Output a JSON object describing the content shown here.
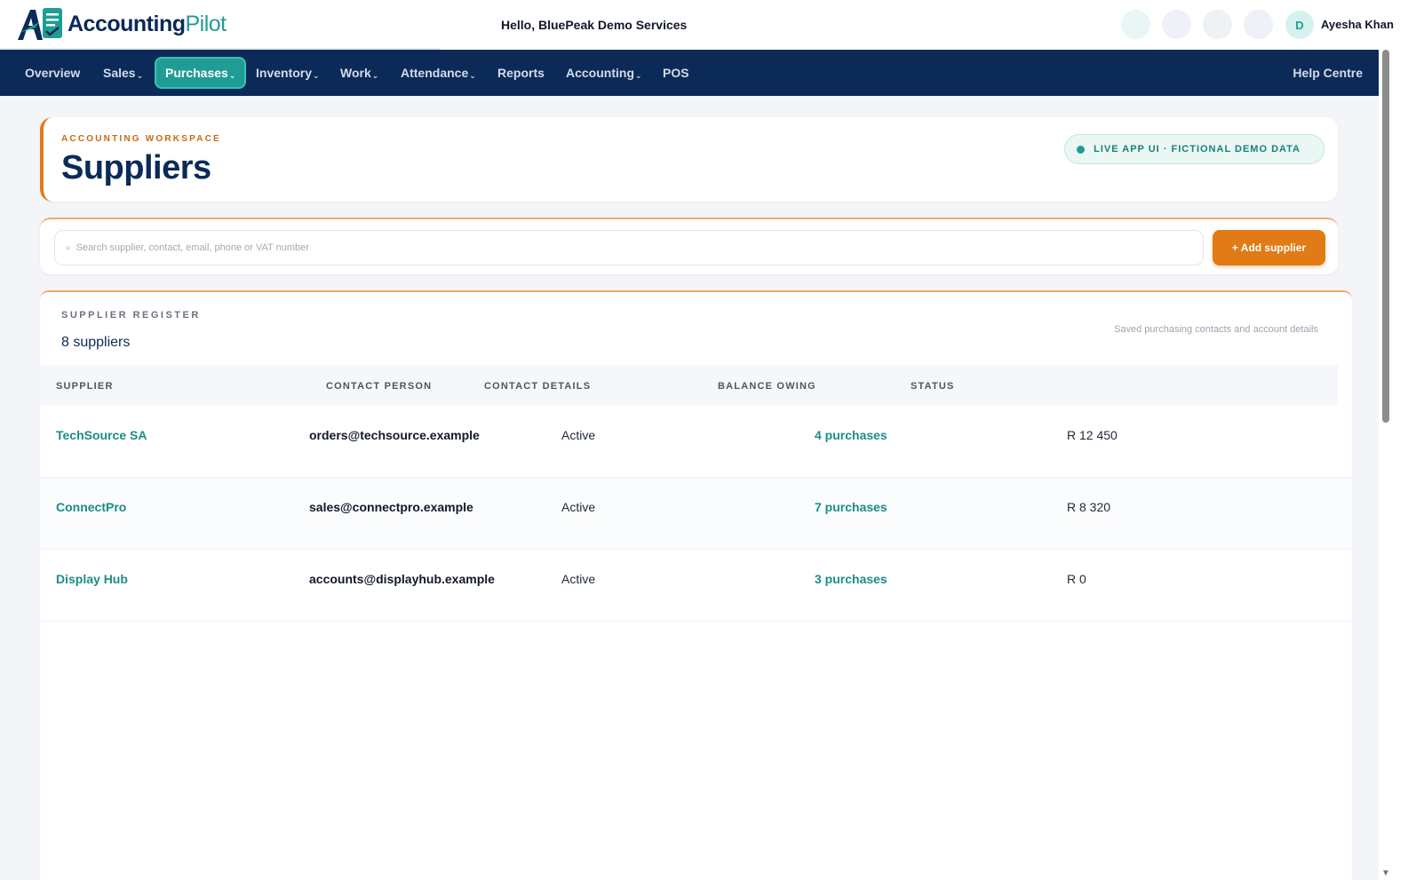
{
  "app": {
    "brand_name": "Accounting",
    "brand_suffix": "Pilot",
    "greeting": "Hello, BluePeak Demo Services",
    "user_initial": "D",
    "user_name": "Ayesha Khan"
  },
  "nav": {
    "items": [
      {
        "label": "Overview",
        "dropdown": false
      },
      {
        "label": "Sales",
        "dropdown": true
      },
      {
        "label": "Purchases",
        "dropdown": true,
        "active": true
      },
      {
        "label": "Inventory",
        "dropdown": true
      },
      {
        "label": "Work",
        "dropdown": true
      },
      {
        "label": "Attendance",
        "dropdown": true
      },
      {
        "label": "Reports",
        "dropdown": false
      },
      {
        "label": "Accounting",
        "dropdown": true
      },
      {
        "label": "POS",
        "dropdown": false
      }
    ],
    "help_label": "Help Centre",
    "caret_glyph": "⌄"
  },
  "header": {
    "eyebrow": "ACCOUNTING WORKSPACE",
    "title": "Suppliers",
    "badge": "LIVE APP UI · FICTIONAL DEMO DATA"
  },
  "search": {
    "icon": "⌕",
    "placeholder": "Search supplier, contact, email, phone or VAT number",
    "value": "",
    "add_label": "+ Add supplier"
  },
  "register": {
    "eyebrow": "SUPPLIER REGISTER",
    "count": "8 suppliers",
    "note": "Saved purchasing contacts and account details",
    "columns": [
      "SUPPLIER",
      "CONTACT PERSON",
      "CONTACT DETAILS",
      "BALANCE OWING",
      "STATUS"
    ],
    "rows": [
      {
        "name": "TechSource SA",
        "email": "orders@techsource.example",
        "status": "Active",
        "purchases": "4 purchases",
        "balance": "R 12 450"
      },
      {
        "name": "ConnectPro",
        "email": "sales@connectpro.example",
        "status": "Active",
        "purchases": "7 purchases",
        "balance": "R 8 320"
      },
      {
        "name": "Display Hub",
        "email": "accounts@displayhub.example",
        "status": "Active",
        "purchases": "3 purchases",
        "balance": "R 0"
      }
    ]
  },
  "colors": {
    "navy": "#0b2a57",
    "teal": "#1f9d94",
    "orange": "#e07b15"
  }
}
